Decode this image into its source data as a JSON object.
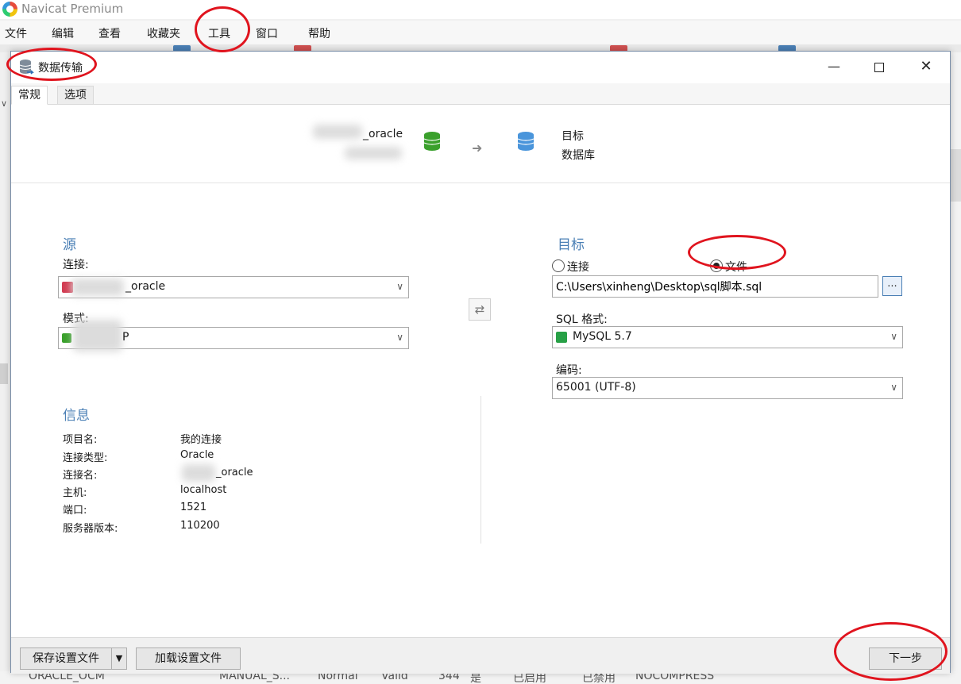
{
  "app": {
    "title": "Navicat Premium",
    "menu": [
      "文件",
      "编辑",
      "查看",
      "收藏夹",
      "工具",
      "窗口",
      "帮助"
    ]
  },
  "background": {
    "left_collapse_glyph": "∨",
    "bottom_row": [
      "ORACLE_OCM",
      "MANUAL_S...",
      "Normal",
      "Valid",
      "344",
      "是",
      "已启用",
      "已禁用",
      "NOCOMPRESS"
    ]
  },
  "dialog": {
    "title": "数据传输",
    "window_controls": {
      "minimize": "—",
      "close": "✕"
    },
    "tabs": [
      "常规",
      "选项"
    ],
    "header": {
      "source_name": "_oracle",
      "arrow": "➜",
      "target_line1": "目标",
      "target_line2": "数据库"
    },
    "source": {
      "title": "源",
      "connection_label": "连接:",
      "connection_value": "_oracle",
      "schema_label": "模式:",
      "schema_value": "P"
    },
    "swap_icon": "⇄",
    "target": {
      "title": "目标",
      "radio_connection": "连接",
      "radio_file": "文件",
      "selected": "file",
      "file_path": "C:\\Users\\xinheng\\Desktop\\sql脚本.sql",
      "browse_label": "...",
      "sql_format_label": "SQL 格式:",
      "sql_format_value": "MySQL 5.7",
      "encoding_label": "编码:",
      "encoding_value": "65001 (UTF-8)"
    },
    "info": {
      "title": "信息",
      "rows": [
        {
          "label": "项目名:",
          "value": "我的连接"
        },
        {
          "label": "连接类型:",
          "value": "Oracle"
        },
        {
          "label": "连接名:",
          "value": "_oracle"
        },
        {
          "label": "主机:",
          "value": "localhost"
        },
        {
          "label": "端口:",
          "value": "1521"
        },
        {
          "label": "服务器版本:",
          "value": "110200"
        }
      ]
    },
    "footer": {
      "save_settings": "保存设置文件",
      "dropdown_glyph": "▼",
      "load_settings": "加载设置文件",
      "next": "下一步"
    },
    "caret": "∨"
  },
  "colors": {
    "section_title": "#4a7fb5",
    "annotation": "#e0141e",
    "source_db": "#3aa02c",
    "target_db": "#4a95db"
  }
}
